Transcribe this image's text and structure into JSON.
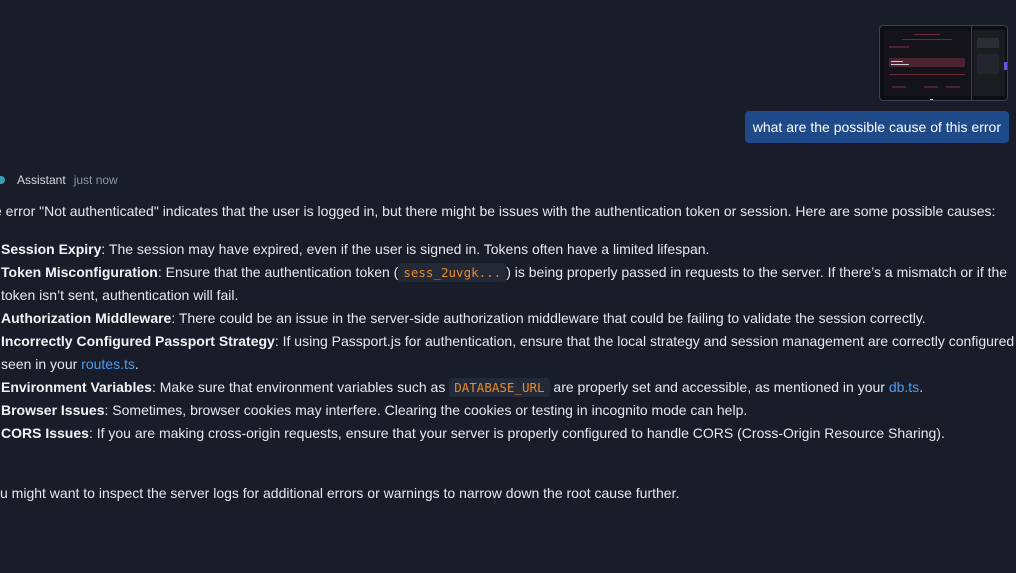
{
  "user_message": {
    "text": "what are the possible cause of this error"
  },
  "assistant": {
    "name": "Assistant",
    "timestamp": "just now",
    "intro": "e error \"Not authenticated\" indicates that the user is logged in, but there might be issues with the authentication token or session. Here are some possible causes:",
    "causes": [
      {
        "title": "Session Expiry",
        "text": ": The session may have expired, even if the user is signed in. Tokens often have a limited lifespan."
      },
      {
        "title": "Token Misconfiguration",
        "text_before": ": Ensure that the authentication token (",
        "code": "sess_2uvgk...",
        "text_after": ") is being properly passed in requests to the server. If there’s a mismatch or if the token isn’t sent, authentication will fail."
      },
      {
        "title": "Authorization Middleware",
        "text": ": There could be an issue in the server-side authorization middleware that could be failing to validate the session correctly."
      },
      {
        "title": "Incorrectly Configured Passport Strategy",
        "text_before": ": If using Passport.js for authentication, ensure that the local strategy and session management are correctly configured seen in your ",
        "link": "routes.ts",
        "text_after": "."
      },
      {
        "title": "Environment Variables",
        "text_before": ": Make sure that environment variables such as ",
        "code": "DATABASE_URL",
        "text_middle": " are properly set and accessible, as mentioned in your ",
        "link": "db.ts",
        "text_after": "."
      },
      {
        "title": "Browser Issues",
        "text": ": Sometimes, browser cookies may interfere. Clearing the cookies or testing in incognito mode can help."
      },
      {
        "title": "CORS Issues",
        "text": ": If you are making cross-origin requests, ensure that your server is properly configured to handle CORS (Cross-Origin Resource Sharing)."
      }
    ],
    "outro": "u might want to inspect the server logs for additional errors or warnings to narrow down the root cause further."
  },
  "colors": {
    "background": "#181d29",
    "user_bubble": "#1f4a8a",
    "code_text": "#e98a2a",
    "link": "#4d9cf0",
    "assistant_dot": "#3aa0b8"
  },
  "icons": {
    "attachment": "screenshot-thumbnail",
    "assistant_avatar": "assistant-status-dot"
  }
}
